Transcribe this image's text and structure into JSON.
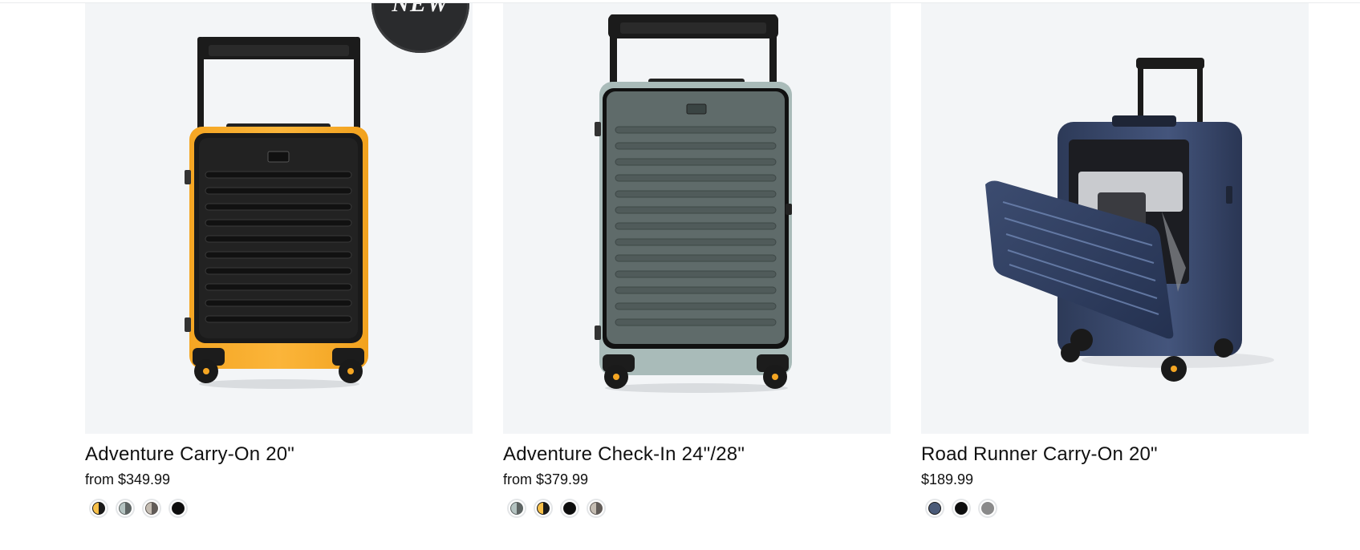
{
  "products": [
    {
      "title": "Adventure Carry-On 20\"",
      "price": "from $349.99",
      "badge": "NEW",
      "body_color": "#f7ae2e",
      "front_color": "#1d1d1d",
      "swatches": [
        {
          "name": "yellow-black",
          "colors": [
            "#f7c04a",
            "#1a1a1a"
          ]
        },
        {
          "name": "sage-gray",
          "colors": [
            "#b4c3c1",
            "#5d6463"
          ]
        },
        {
          "name": "taupe-gray",
          "colors": [
            "#c4bcb2",
            "#615b57"
          ]
        },
        {
          "name": "black",
          "colors": [
            "#0d0d0d",
            "#0d0d0d"
          ]
        }
      ]
    },
    {
      "title": "Adventure Check-In 24\"/28\"",
      "price": "from $379.99",
      "body_color": "#a9bbb9",
      "front_color": "#5a6564",
      "swatches": [
        {
          "name": "sage-gray",
          "colors": [
            "#b4c3c1",
            "#5d6463"
          ]
        },
        {
          "name": "yellow-black",
          "colors": [
            "#f7c04a",
            "#1a1a1a"
          ]
        },
        {
          "name": "black",
          "colors": [
            "#0d0d0d",
            "#0d0d0d"
          ]
        },
        {
          "name": "taupe-gray",
          "colors": [
            "#c4bcb2",
            "#615b57"
          ]
        }
      ]
    },
    {
      "title": "Road Runner Carry-On 20\"",
      "price": "$189.99",
      "body_color": "#3a4b70",
      "front_color": "#2c3a58",
      "swatches": [
        {
          "name": "navy",
          "colors": [
            "#4a5a78",
            "#4a5a78"
          ]
        },
        {
          "name": "black",
          "colors": [
            "#0d0d0d",
            "#0d0d0d"
          ]
        },
        {
          "name": "gray",
          "colors": [
            "#8a8a8a",
            "#8a8a8a"
          ]
        }
      ]
    }
  ]
}
